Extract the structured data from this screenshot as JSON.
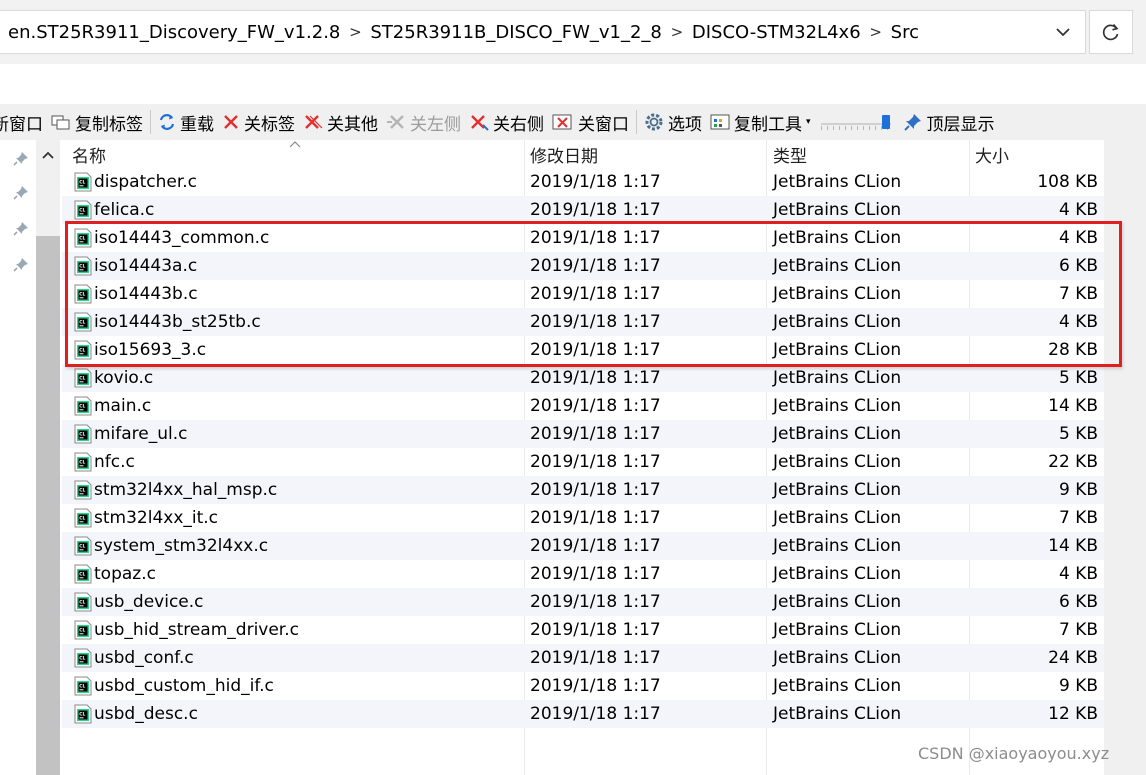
{
  "address_bar": {
    "path": [
      "en.ST25R3911_Discovery_FW_v1.2.8",
      "ST25R3911B_DISCO_FW_v1_2_8",
      "DISCO-STM32L4x6",
      "Src"
    ],
    "separator": ">",
    "dropdown_icon": "chevron-down-icon",
    "refresh_icon": "refresh-icon"
  },
  "toolbar": {
    "items": [
      {
        "label": "新窗口",
        "icon": "new-window-icon"
      },
      {
        "label": "复制标签",
        "icon": "copy-tab-icon"
      },
      {
        "label": "重载",
        "icon": "reload-icon"
      },
      {
        "label": "关标签",
        "icon": "close-tab-icon"
      },
      {
        "label": "关其他",
        "icon": "close-others-icon"
      },
      {
        "label": "关左侧",
        "icon": "close-left-icon",
        "disabled": true
      },
      {
        "label": "关右侧",
        "icon": "close-right-icon"
      },
      {
        "label": "关窗口",
        "icon": "close-window-icon"
      },
      {
        "label": "选项",
        "icon": "gear-icon"
      },
      {
        "label": "复制工具",
        "icon": "copy-tool-icon"
      },
      {
        "label": "顶层显示",
        "icon": "pin-top-icon"
      }
    ],
    "slider_level": 0.9
  },
  "columns": {
    "name": "名称",
    "date": "修改日期",
    "type": "类型",
    "size": "大小"
  },
  "files": [
    {
      "name": "dispatcher.c",
      "date": "2019/1/18 1:17",
      "type": "JetBrains CLion",
      "size": "108 KB"
    },
    {
      "name": "felica.c",
      "date": "2019/1/18 1:17",
      "type": "JetBrains CLion",
      "size": "4 KB"
    },
    {
      "name": "iso14443_common.c",
      "date": "2019/1/18 1:17",
      "type": "JetBrains CLion",
      "size": "4 KB"
    },
    {
      "name": "iso14443a.c",
      "date": "2019/1/18 1:17",
      "type": "JetBrains CLion",
      "size": "6 KB"
    },
    {
      "name": "iso14443b.c",
      "date": "2019/1/18 1:17",
      "type": "JetBrains CLion",
      "size": "7 KB"
    },
    {
      "name": "iso14443b_st25tb.c",
      "date": "2019/1/18 1:17",
      "type": "JetBrains CLion",
      "size": "4 KB"
    },
    {
      "name": "iso15693_3.c",
      "date": "2019/1/18 1:17",
      "type": "JetBrains CLion",
      "size": "28 KB"
    },
    {
      "name": "kovio.c",
      "date": "2019/1/18 1:17",
      "type": "JetBrains CLion",
      "size": "5 KB"
    },
    {
      "name": "main.c",
      "date": "2019/1/18 1:17",
      "type": "JetBrains CLion",
      "size": "14 KB"
    },
    {
      "name": "mifare_ul.c",
      "date": "2019/1/18 1:17",
      "type": "JetBrains CLion",
      "size": "5 KB"
    },
    {
      "name": "nfc.c",
      "date": "2019/1/18 1:17",
      "type": "JetBrains CLion",
      "size": "22 KB"
    },
    {
      "name": "stm32l4xx_hal_msp.c",
      "date": "2019/1/18 1:17",
      "type": "JetBrains CLion",
      "size": "9 KB"
    },
    {
      "name": "stm32l4xx_it.c",
      "date": "2019/1/18 1:17",
      "type": "JetBrains CLion",
      "size": "7 KB"
    },
    {
      "name": "system_stm32l4xx.c",
      "date": "2019/1/18 1:17",
      "type": "JetBrains CLion",
      "size": "14 KB"
    },
    {
      "name": "topaz.c",
      "date": "2019/1/18 1:17",
      "type": "JetBrains CLion",
      "size": "4 KB"
    },
    {
      "name": "usb_device.c",
      "date": "2019/1/18 1:17",
      "type": "JetBrains CLion",
      "size": "6 KB"
    },
    {
      "name": "usb_hid_stream_driver.c",
      "date": "2019/1/18 1:17",
      "type": "JetBrains CLion",
      "size": "7 KB"
    },
    {
      "name": "usbd_conf.c",
      "date": "2019/1/18 1:17",
      "type": "JetBrains CLion",
      "size": "24 KB"
    },
    {
      "name": "usbd_custom_hid_if.c",
      "date": "2019/1/18 1:17",
      "type": "JetBrains CLion",
      "size": "9 KB"
    },
    {
      "name": "usbd_desc.c",
      "date": "2019/1/18 1:17",
      "type": "JetBrains CLion",
      "size": "12 KB"
    }
  ],
  "file_icon": "clion-file-icon",
  "highlight": {
    "rows": "iso14443_common.c – iso15693_3.c",
    "color": "#e02020"
  },
  "watermark": "CSDN @xiaoyaoyou.xyz",
  "colors": {
    "alt_row": "#f3f5fb",
    "toolbar_bg": "#f0f0f0",
    "accent": "#1e6fd9"
  }
}
